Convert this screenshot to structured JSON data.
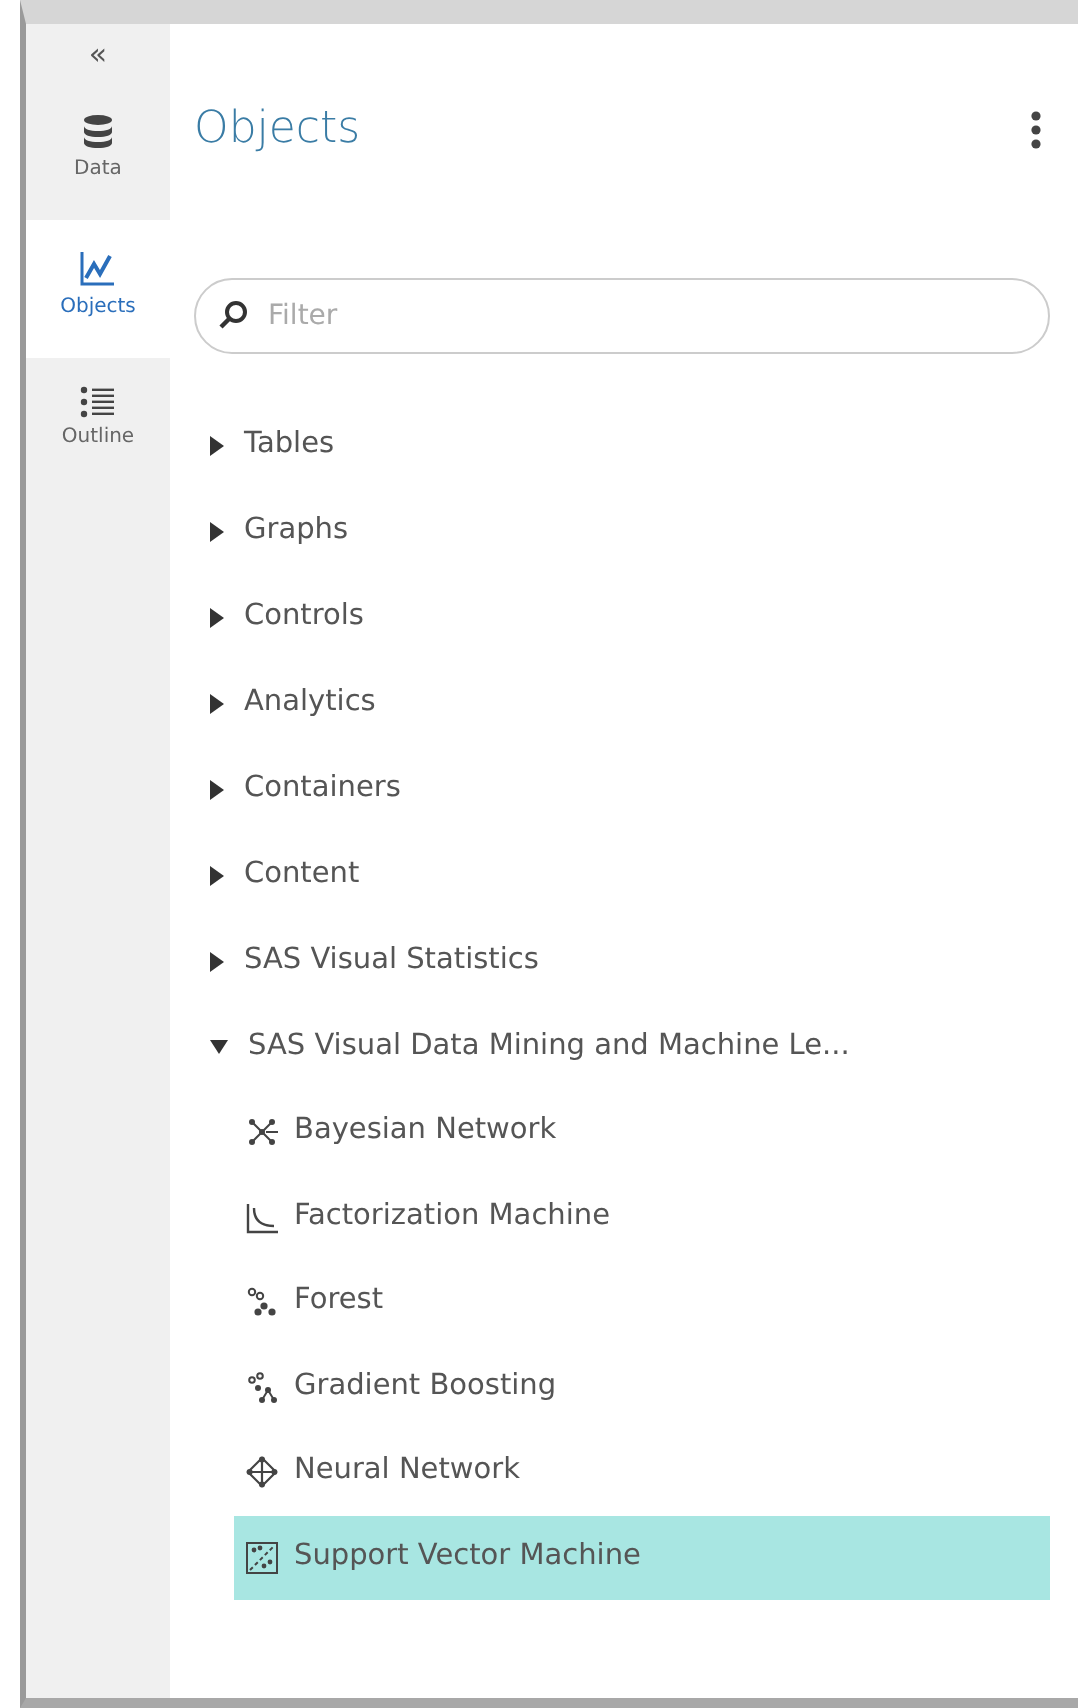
{
  "rail": {
    "collapse": "«",
    "tabs": [
      {
        "label": "Data",
        "kind": "data",
        "selected": false
      },
      {
        "label": "Objects",
        "kind": "objects",
        "selected": true
      },
      {
        "label": "Outline",
        "kind": "outline",
        "selected": false
      }
    ]
  },
  "panel": {
    "title": "Objects",
    "search": {
      "placeholder": "Filter"
    },
    "tree": [
      {
        "label": "Tables",
        "expanded": false
      },
      {
        "label": "Graphs",
        "expanded": false
      },
      {
        "label": "Controls",
        "expanded": false
      },
      {
        "label": "Analytics",
        "expanded": false
      },
      {
        "label": "Containers",
        "expanded": false
      },
      {
        "label": "Content",
        "expanded": false
      },
      {
        "label": "SAS Visual Statistics",
        "expanded": false
      },
      {
        "label": "SAS Visual Data Mining and Machine Le...",
        "expanded": true,
        "children": [
          {
            "label": "Bayesian Network",
            "kind": "bayesian",
            "selected": false
          },
          {
            "label": "Factorization Machine",
            "kind": "factorization",
            "selected": false
          },
          {
            "label": "Forest",
            "kind": "forest",
            "selected": false
          },
          {
            "label": "Gradient Boosting",
            "kind": "boosting",
            "selected": false
          },
          {
            "label": "Neural Network",
            "kind": "neural",
            "selected": false
          },
          {
            "label": "Support Vector Machine",
            "kind": "svm",
            "selected": true
          }
        ]
      }
    ]
  }
}
